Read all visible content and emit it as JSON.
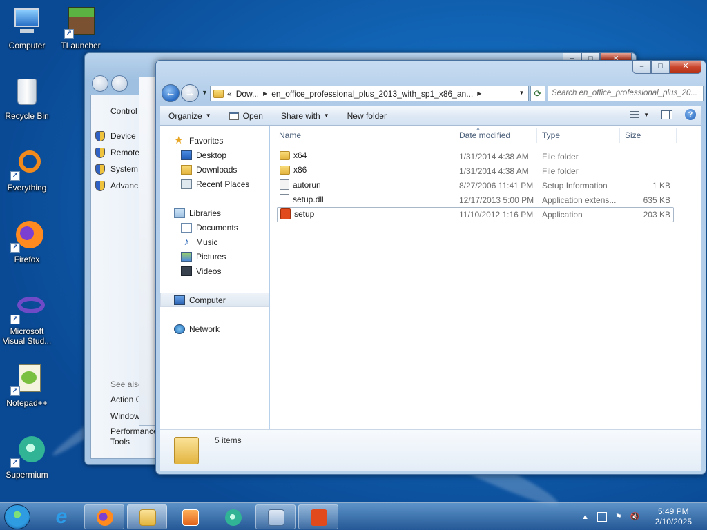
{
  "desktop": {
    "icons": [
      {
        "label": "Computer",
        "icon": "computer-icon"
      },
      {
        "label": "TLauncher",
        "icon": "tlauncher-icon"
      },
      {
        "label": "Recycle Bin",
        "icon": "recycle-bin-icon"
      },
      {
        "label": "Everything",
        "icon": "everything-icon"
      },
      {
        "label": "Firefox",
        "icon": "firefox-icon"
      },
      {
        "label": "Microsoft Visual Stud...",
        "icon": "visual-studio-icon"
      },
      {
        "label": "Notepad++",
        "icon": "notepadpp-icon"
      },
      {
        "label": "Supermium",
        "icon": "supermium-icon"
      }
    ]
  },
  "bg_window": {
    "title": "Control",
    "links": [
      "Device I",
      "Remote",
      "System",
      "Advanc"
    ],
    "see_also": "See also",
    "see_also_links": [
      "Action C",
      "Window",
      "Performance",
      "Tools"
    ]
  },
  "explorer": {
    "address": {
      "chevron": "«",
      "crumbs": [
        "Dow...",
        "en_office_professional_plus_2013_with_sp1_x86_an..."
      ]
    },
    "search_placeholder": "Search en_office_professional_plus_20...",
    "toolbar": {
      "organize": "Organize",
      "open": "Open",
      "share_with": "Share with",
      "new_folder": "New folder"
    },
    "nav": {
      "favorites": "Favorites",
      "desktop": "Desktop",
      "downloads": "Downloads",
      "recent_places": "Recent Places",
      "libraries": "Libraries",
      "documents": "Documents",
      "music": "Music",
      "pictures": "Pictures",
      "videos": "Videos",
      "computer": "Computer",
      "network": "Network"
    },
    "columns": {
      "name": "Name",
      "date": "Date modified",
      "type": "Type",
      "size": "Size"
    },
    "files": [
      {
        "name": "x64",
        "date": "1/31/2014 4:38 AM",
        "type": "File folder",
        "size": "",
        "icon": "folder-icon"
      },
      {
        "name": "x86",
        "date": "1/31/2014 4:38 AM",
        "type": "File folder",
        "size": "",
        "icon": "folder-icon"
      },
      {
        "name": "autorun",
        "date": "8/27/2006 11:41 PM",
        "type": "Setup Information",
        "size": "1 KB",
        "icon": "setup-info-icon"
      },
      {
        "name": "setup.dll",
        "date": "12/17/2013 5:00 PM",
        "type": "Application extens...",
        "size": "635 KB",
        "icon": "dll-icon"
      },
      {
        "name": "setup",
        "date": "11/10/2012 1:16 PM",
        "type": "Application",
        "size": "203 KB",
        "icon": "office-setup-icon"
      }
    ],
    "status": "5 items"
  },
  "taskbar": {
    "apps": [
      "internet-explorer-icon",
      "firefox-icon",
      "file-explorer-icon",
      "media-player-icon",
      "supermium-icon",
      "control-panel-icon",
      "office-icon"
    ],
    "time": "5:49 PM",
    "date": "2/10/2025"
  },
  "colors": {
    "accent": "#1f5cb8",
    "close_button": "#c9452c",
    "office": "#e04a1c"
  }
}
